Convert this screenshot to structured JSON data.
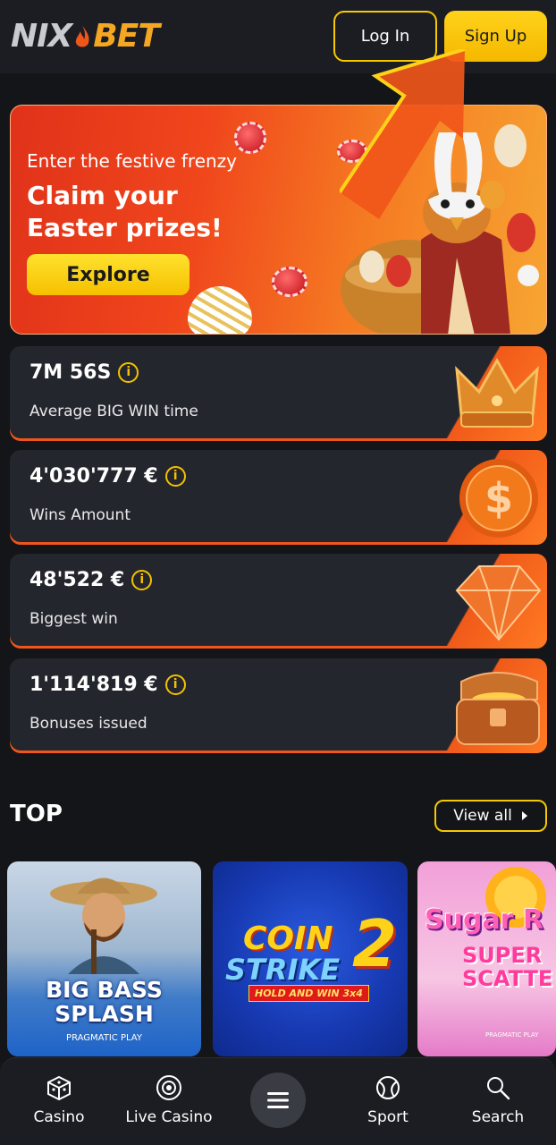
{
  "header": {
    "logo_left": "NIX",
    "logo_right": "BET",
    "login_label": "Log In",
    "signup_label": "Sign Up"
  },
  "banner": {
    "subtitle": "Enter the festive frenzy",
    "title": "Claim your Easter prizes!",
    "cta_label": "Explore"
  },
  "stats": [
    {
      "value": "7M 56S",
      "label": "Average BIG WIN time",
      "icon": "crown-icon"
    },
    {
      "value": "4'030'777 €",
      "label": "Wins Amount",
      "icon": "dollar-coin-icon"
    },
    {
      "value": "48'522 €",
      "label": "Biggest win",
      "icon": "diamond-icon"
    },
    {
      "value": "1'114'819 €",
      "label": "Bonuses issued",
      "icon": "treasure-chest-icon"
    }
  ],
  "top": {
    "title": "TOP",
    "view_all_label": "View all",
    "games": [
      {
        "title": "BIG BASS SPLASH",
        "provider": "PRAGMATIC PLAY"
      },
      {
        "title_line1": "COIN",
        "title_line2": "STRIKE",
        "title_num": "2",
        "subtitle": "HOLD AND WIN 3x4"
      },
      {
        "title_line1": "Sugar R",
        "title_line2": "SUPER SCATTE",
        "provider": "PRAGMATIC PLAY"
      }
    ]
  },
  "bottom_nav": {
    "items": [
      {
        "label": "Casino",
        "icon": "dice-icon"
      },
      {
        "label": "Live Casino",
        "icon": "chip-icon"
      },
      {
        "label": "",
        "icon": "hamburger-menu-icon"
      },
      {
        "label": "Sport",
        "icon": "tennis-ball-icon"
      },
      {
        "label": "Search",
        "icon": "search-icon"
      }
    ]
  },
  "colors": {
    "background": "#141518",
    "accent_yellow": "#f5c000",
    "accent_orange": "#f0561a",
    "card": "#24262d"
  }
}
